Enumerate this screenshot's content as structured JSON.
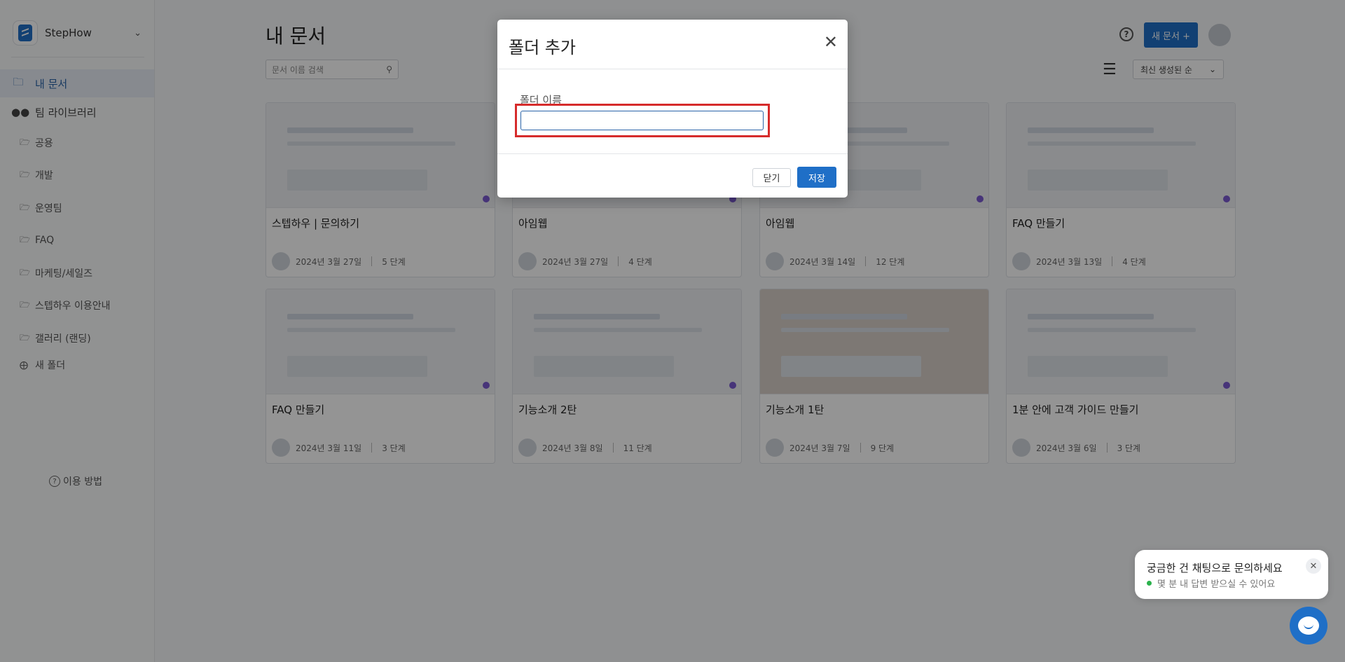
{
  "sidebar": {
    "brand": "StepHow",
    "my_docs": "내 문서",
    "team_library": "팀 라이브러리",
    "folders": [
      "공용",
      "개발",
      "운영팀",
      "FAQ",
      "마케팅/세일즈",
      "스텝하우 이용안내",
      "갤러리 (랜딩)"
    ],
    "new_folder": "새 폴더",
    "help": "이용 방법"
  },
  "header": {
    "title": "내 문서",
    "search_placeholder": "문서 이름 검색",
    "new_doc": "새 문서 +",
    "sort": "최신 생성된 순"
  },
  "cards": [
    {
      "title": "스텝하우 | 문의하기",
      "date": "2024년 3월 27일",
      "steps": "5 단계"
    },
    {
      "title": "아임웹",
      "date": "2024년 3월 27일",
      "steps": "4 단계"
    },
    {
      "title": "아임웹",
      "date": "2024년 3월 14일",
      "steps": "12 단계"
    },
    {
      "title": "FAQ 만들기",
      "date": "2024년 3월 13일",
      "steps": "4 단계"
    },
    {
      "title": "FAQ 만들기",
      "date": "2024년 3월 11일",
      "steps": "3 단계"
    },
    {
      "title": "기능소개 2탄",
      "date": "2024년 3월 8일",
      "steps": "11 단계"
    },
    {
      "title": "기능소개 1탄",
      "date": "2024년 3월 7일",
      "steps": "9 단계"
    },
    {
      "title": "1분 안에 고객 가이드 만들기",
      "date": "2024년 3월 6일",
      "steps": "3 단계"
    }
  ],
  "modal": {
    "title": "폴더 추가",
    "field_label": "폴더 이름",
    "field_value": "",
    "close_label": "닫기",
    "save_label": "저장"
  },
  "chat": {
    "title": "궁금한 건 채팅으로 문의하세요",
    "subtitle": "몇 분 내 답변 받으실 수 있어요"
  },
  "colors": {
    "accent": "#1f6fc7",
    "highlight": "#d62b2b"
  }
}
